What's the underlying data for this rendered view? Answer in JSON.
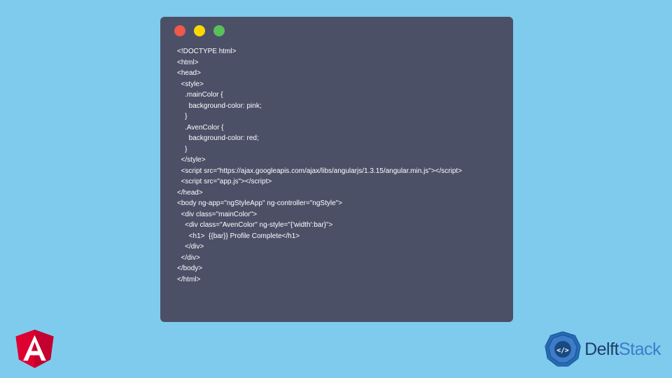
{
  "window": {
    "dots": {
      "red": "#ed594a",
      "yellow": "#fdd800",
      "green": "#5ac05a"
    }
  },
  "code": {
    "lines": [
      "<!DOCTYPE html>",
      "<html>",
      "<head>",
      "  <style>",
      "    .mainColor {",
      "      background-color: pink;",
      "    }",
      "    .AvenColor {",
      "      background-color: red;",
      "    }",
      "  </style>",
      "  <script src=\"https://ajax.googleapis.com/ajax/libs/angularjs/1.3.15/angular.min.js\"></script>",
      "  <script src=\"app.js\"></script>",
      "</head>",
      "<body ng-app=\"ngStyleApp\" ng-controller=\"ngStyle\">",
      "  <div class=\"mainColor\">",
      "    <div class=\"AvenColor\" ng-style=\"{'width':bar}\">",
      "      <h1>  {{bar}} Profile Complete</h1>",
      "    </div>",
      "  </div>",
      "</body>",
      "</html>"
    ]
  },
  "logos": {
    "angular": "angular-logo",
    "delft_brand": "DelftStack",
    "delft_first": "Delft",
    "delft_second": "Stack"
  }
}
